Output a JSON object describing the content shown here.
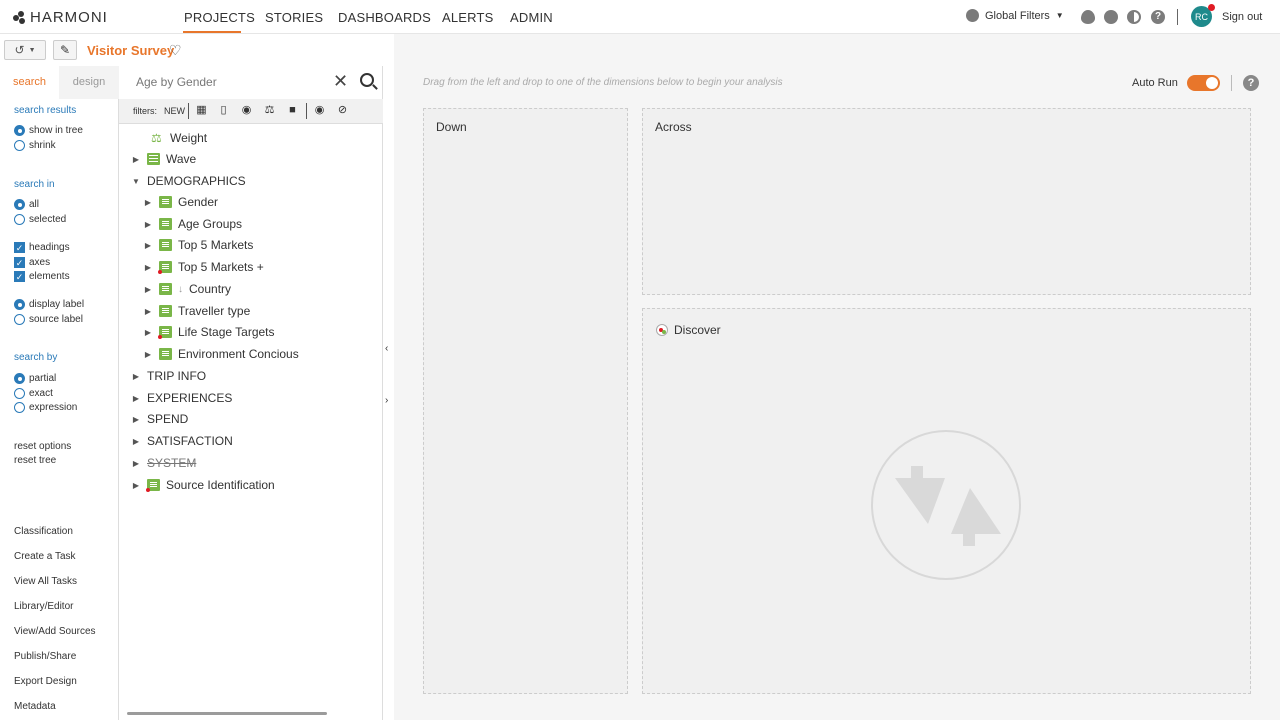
{
  "app": {
    "logo": "HARMONI"
  },
  "nav": {
    "items": [
      "PROJECTS",
      "STORIES",
      "DASHBOARDS",
      "ALERTS",
      "ADMIN"
    ],
    "active": "PROJECTS",
    "global_filters": "Global Filters",
    "avatar_initials": "RC",
    "sign_out": "Sign out"
  },
  "toolbar": {
    "title": "Visitor Survey"
  },
  "left_tabs": {
    "search": "search",
    "design": "design"
  },
  "options": {
    "search_results": {
      "heading": "search results",
      "show_in_tree": "show in tree",
      "shrink": "shrink"
    },
    "search_in": {
      "heading": "search in",
      "all": "all",
      "selected": "selected",
      "headings": "headings",
      "axes": "axes",
      "elements": "elements",
      "display_label": "display label",
      "source_label": "source label"
    },
    "search_by": {
      "heading": "search by",
      "partial": "partial",
      "exact": "exact",
      "expression": "expression"
    },
    "reset_options": "reset options",
    "reset_tree": "reset tree"
  },
  "bottom_links": [
    "Classification",
    "Create a Task",
    "View All Tasks",
    "Library/Editor",
    "View/Add Sources",
    "Publish/Share",
    "Export Design",
    "Metadata"
  ],
  "search": {
    "placeholder": "Age by Gender"
  },
  "filters": {
    "label": "filters:",
    "new": "NEW"
  },
  "tree": [
    {
      "label": "Weight"
    },
    {
      "label": "Wave"
    },
    {
      "label": "DEMOGRAPHICS"
    },
    {
      "label": "Gender"
    },
    {
      "label": "Age Groups"
    },
    {
      "label": "Top 5 Markets"
    },
    {
      "label": "Top 5 Markets +"
    },
    {
      "label": "Country"
    },
    {
      "label": "Traveller type"
    },
    {
      "label": "Life Stage Targets"
    },
    {
      "label": "Environment Concious"
    },
    {
      "label": "TRIP INFO"
    },
    {
      "label": "EXPERIENCES"
    },
    {
      "label": "SPEND"
    },
    {
      "label": "SATISFACTION"
    },
    {
      "label": "SYSTEM"
    },
    {
      "label": "Source Identification"
    }
  ],
  "analysis": {
    "hint": "Drag from the left and drop to one of the dimensions below to begin your analysis",
    "auto_run": "Auto Run",
    "down": "Down",
    "across": "Across",
    "discover": "Discover"
  },
  "colors": {
    "accent": "#e8762b",
    "link": "#2a7ab8",
    "variable": "#7ab648"
  }
}
